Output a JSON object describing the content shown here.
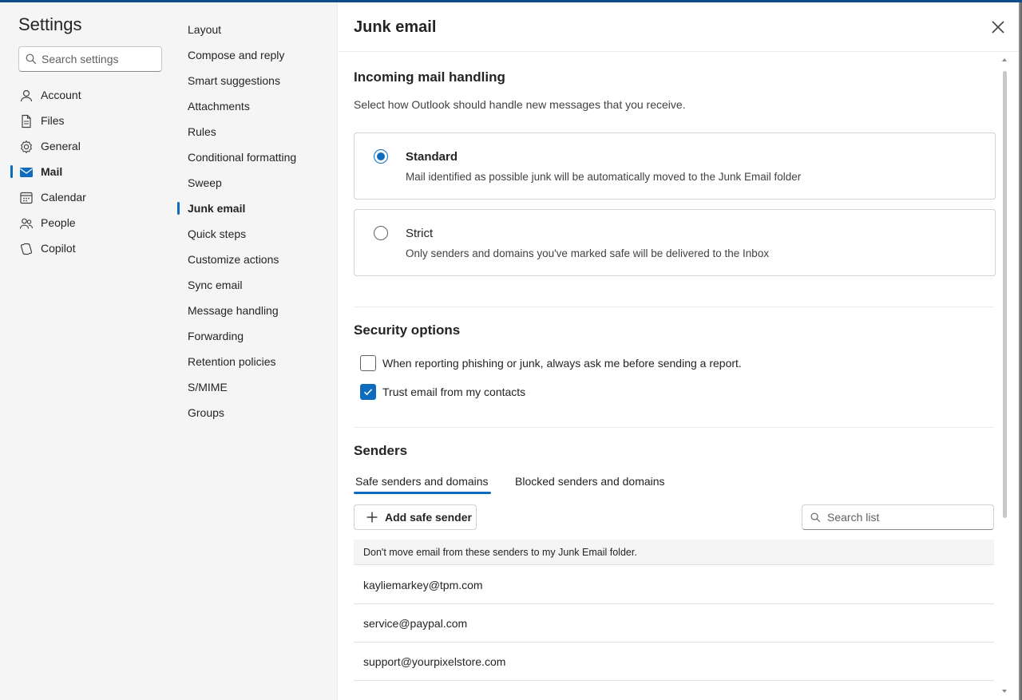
{
  "sidebar": {
    "title": "Settings",
    "search_placeholder": "Search settings",
    "items": [
      {
        "label": "Account",
        "icon": "person-icon"
      },
      {
        "label": "Files",
        "icon": "file-icon"
      },
      {
        "label": "General",
        "icon": "gear-icon"
      },
      {
        "label": "Mail",
        "icon": "mail-icon"
      },
      {
        "label": "Calendar",
        "icon": "calendar-icon"
      },
      {
        "label": "People",
        "icon": "people-icon"
      },
      {
        "label": "Copilot",
        "icon": "copilot-icon"
      }
    ],
    "active": "Mail"
  },
  "mail_menu": {
    "items": [
      "Layout",
      "Compose and reply",
      "Smart suggestions",
      "Attachments",
      "Rules",
      "Conditional formatting",
      "Sweep",
      "Junk email",
      "Quick steps",
      "Customize actions",
      "Sync email",
      "Message handling",
      "Forwarding",
      "Retention policies",
      "S/MIME",
      "Groups"
    ],
    "active": "Junk email"
  },
  "page": {
    "title": "Junk email"
  },
  "incoming": {
    "heading": "Incoming mail handling",
    "description": "Select how Outlook should handle new messages that you receive.",
    "options": [
      {
        "title": "Standard",
        "subtitle": "Mail identified as possible junk will be automatically moved to the Junk Email folder",
        "selected": true
      },
      {
        "title": "Strict",
        "subtitle": "Only senders and domains you've marked safe will be delivered to the Inbox",
        "selected": false
      }
    ]
  },
  "security": {
    "heading": "Security options",
    "options": [
      {
        "label": "When reporting phishing or junk, always ask me before sending a report.",
        "checked": false
      },
      {
        "label": "Trust email from my contacts",
        "checked": true
      }
    ]
  },
  "senders": {
    "heading": "Senders",
    "tabs": [
      "Safe senders and domains",
      "Blocked senders and domains"
    ],
    "active_tab": "Safe senders and domains",
    "add_button": "Add safe sender",
    "search_placeholder": "Search list",
    "list_header": "Don't move email from these senders to my Junk Email folder.",
    "entries": [
      "kayliemarkey@tpm.com",
      "service@paypal.com",
      "support@yourpixelstore.com"
    ]
  },
  "colors": {
    "accent": "#0f6cbd",
    "panel_bg": "#f5f5f5"
  }
}
